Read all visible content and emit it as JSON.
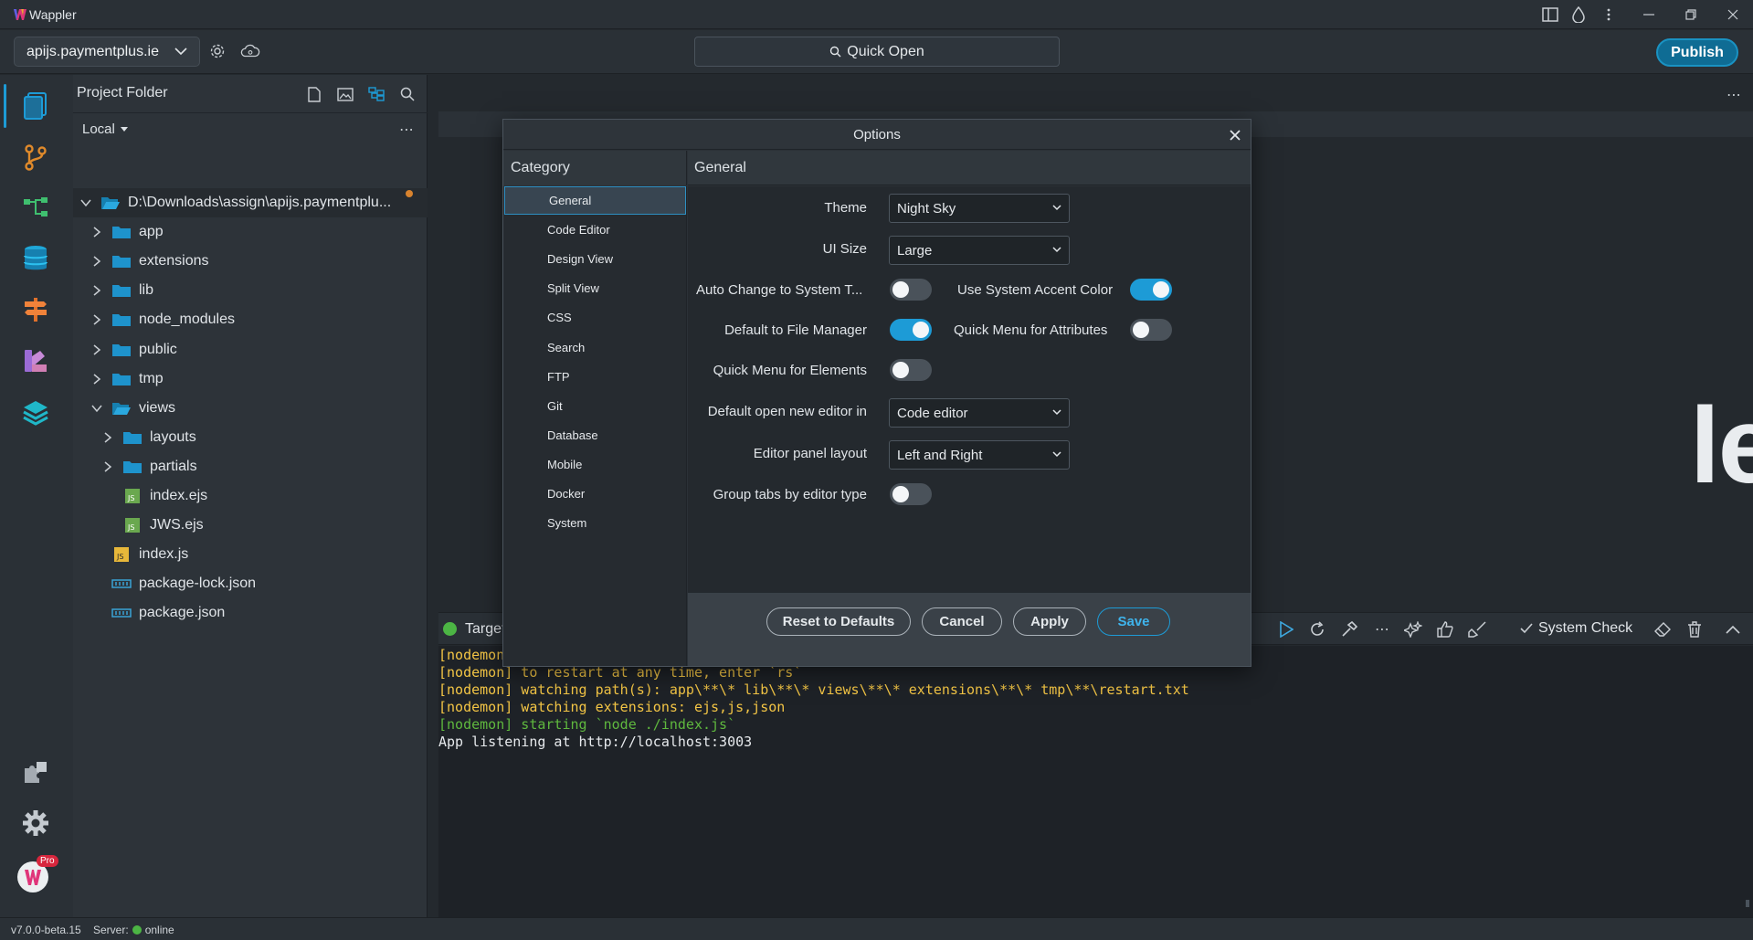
{
  "app": {
    "name": "Wappler",
    "project": "apijs.paymentplus.ie",
    "quick_open": "Quick Open",
    "publish": "Publish",
    "version": "v7.0.0-beta.15",
    "server_label": "Server:",
    "server_status": "online",
    "pro_badge": "Pro"
  },
  "project_panel": {
    "title": "Project Folder",
    "location": "Local",
    "more": "⋯",
    "tree": [
      {
        "label": "D:\\Downloads\\assign\\apijs.paymentplu...",
        "type": "root",
        "icon": "folder-open-icon"
      },
      {
        "label": "app",
        "type": "folder"
      },
      {
        "label": "extensions",
        "type": "folder"
      },
      {
        "label": "lib",
        "type": "folder"
      },
      {
        "label": "node_modules",
        "type": "folder"
      },
      {
        "label": "public",
        "type": "folder"
      },
      {
        "label": "tmp",
        "type": "folder"
      },
      {
        "label": "views",
        "type": "folder-open"
      },
      {
        "label": "layouts",
        "type": "folder"
      },
      {
        "label": "partials",
        "type": "folder"
      },
      {
        "label": "index.ejs",
        "type": "ejs"
      },
      {
        "label": "JWS.ejs",
        "type": "ejs"
      },
      {
        "label": "index.js",
        "type": "js"
      },
      {
        "label": "package-lock.json",
        "type": "json"
      },
      {
        "label": "package.json",
        "type": "json"
      }
    ]
  },
  "editor": {
    "watermark": "ler",
    "more": "⋯"
  },
  "terminal": {
    "target": "Target",
    "system_check": "System Check",
    "lines": [
      {
        "text": "[nodemon",
        "color": "yellow"
      },
      {
        "text": "[nodemon] to restart at any time, enter `rs`",
        "color": "yellow"
      },
      {
        "text": "[nodemon] watching path(s): app\\**\\* lib\\**\\* views\\**\\* extensions\\**\\* tmp\\**\\restart.txt",
        "color": "yellow"
      },
      {
        "text": "[nodemon] watching extensions: ejs,js,json",
        "color": "yellow"
      },
      {
        "text": "[nodemon] starting `node ./index.js`",
        "color": "green"
      },
      {
        "text": "App listening at http://localhost:3003",
        "color": "white"
      }
    ]
  },
  "options": {
    "title": "Options",
    "category_header": "Category",
    "section_header": "General",
    "categories": [
      "General",
      "Code Editor",
      "Design View",
      "Split View",
      "CSS",
      "Search",
      "FTP",
      "Git",
      "Database",
      "Mobile",
      "Docker",
      "System"
    ],
    "active_category": "General",
    "theme_label": "Theme",
    "theme_value": "Night Sky",
    "ui_size_label": "UI Size",
    "ui_size_value": "Large",
    "auto_change_label": "Auto Change to System T...",
    "auto_change_on": false,
    "accent_label": "Use System Accent Color",
    "accent_on": true,
    "file_manager_label": "Default to File Manager",
    "file_manager_on": true,
    "quick_attr_label": "Quick Menu for Attributes",
    "quick_attr_on": false,
    "quick_elem_label": "Quick Menu for Elements",
    "quick_elem_on": false,
    "open_editor_label": "Default open new editor in",
    "open_editor_value": "Code editor",
    "panel_layout_label": "Editor panel layout",
    "panel_layout_value": "Left and Right",
    "group_tabs_label": "Group tabs by editor type",
    "group_tabs_on": false,
    "reset_label": "Reset to Defaults",
    "cancel_label": "Cancel",
    "apply_label": "Apply",
    "save_label": "Save"
  },
  "colors": {
    "accent": "#1d9bd6",
    "background": "#24292e",
    "panel": "#2d3339",
    "modified_dot": "#d8832e",
    "online": "#4cb544"
  }
}
